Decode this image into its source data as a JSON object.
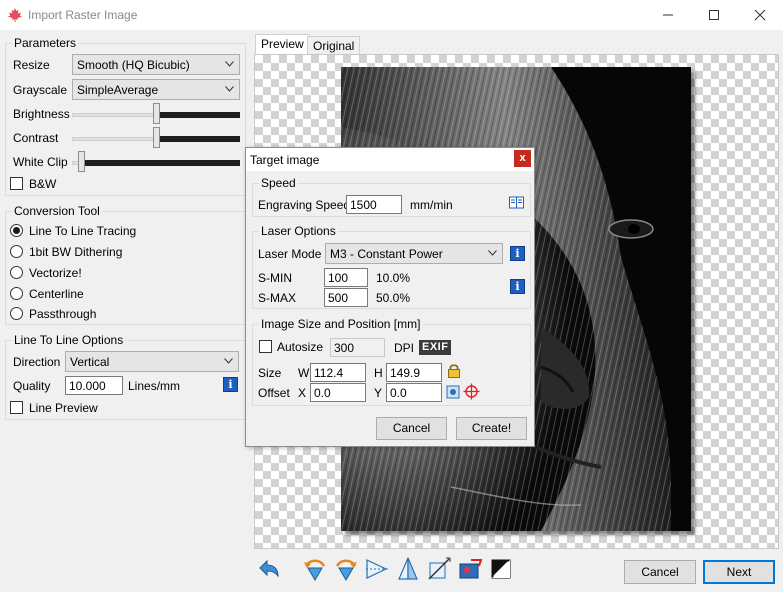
{
  "window": {
    "title": "Import Raster Image",
    "controls": [
      "minimize-icon",
      "maximize-icon",
      "close-icon"
    ]
  },
  "parameters": {
    "title": "Parameters",
    "resize_label": "Resize",
    "resize_value": "Smooth (HQ Bicubic)",
    "grayscale_label": "Grayscale",
    "grayscale_value": "SimpleAverage",
    "brightness_label": "Brightness",
    "brightness_level": 0.5,
    "contrast_label": "Contrast",
    "contrast_level": 0.5,
    "whiteclip_label": "White Clip",
    "whiteclip_level": 0.04,
    "bw_label": "B&W",
    "bw_checked": false
  },
  "conversion": {
    "title": "Conversion Tool",
    "options": [
      "Line To Line Tracing",
      "1bit BW Dithering",
      "Vectorize!",
      "Centerline",
      "Passthrough"
    ],
    "selected": 0
  },
  "line_options": {
    "title": "Line To Line Options",
    "direction_label": "Direction",
    "direction_value": "Vertical",
    "quality_label": "Quality",
    "quality_value": "10.000",
    "quality_unit": "Lines/mm",
    "preview_label": "Line Preview",
    "preview_checked": false
  },
  "tabs": [
    "Preview",
    "Original"
  ],
  "active_tab": 0,
  "footer": {
    "cancel_label": "Cancel",
    "next_label": "Next",
    "tools": [
      "reset-icon",
      "rotate-ccw-icon",
      "rotate-cw-icon",
      "flip-horizontal-icon",
      "flip-vertical-icon",
      "crop-icon",
      "auto-trim-icon",
      "invert-icon"
    ]
  },
  "dialog": {
    "title": "Target image",
    "speed_group": "Speed",
    "speed_label": "Engraving Speed",
    "speed_value": "1500",
    "speed_unit": "mm/min",
    "laser_group": "Laser Options",
    "mode_label": "Laser Mode",
    "mode_value": "M3 - Constant Power",
    "smin_label": "S-MIN",
    "smin_value": "100",
    "smin_pct": "10.0%",
    "smax_label": "S-MAX",
    "smax_value": "500",
    "smax_pct": "50.0%",
    "size_group": "Image Size and Position [mm]",
    "autosize_label": "Autosize",
    "autosize_checked": false,
    "dpi_value": "300",
    "dpi_label": "DPI",
    "exif_label": "EXIF",
    "size_label": "Size",
    "w_label": "W",
    "w_value": "112.4",
    "h_label": "H",
    "h_value": "149.9",
    "offset_label": "Offset",
    "x_label": "X",
    "x_value": "0.0",
    "y_label": "Y",
    "y_value": "0.0",
    "cancel_label": "Cancel",
    "create_label": "Create!"
  },
  "colors": {
    "accent": "#0078d7",
    "info": "#1f5fbf",
    "close_red": "#c42b1c"
  }
}
